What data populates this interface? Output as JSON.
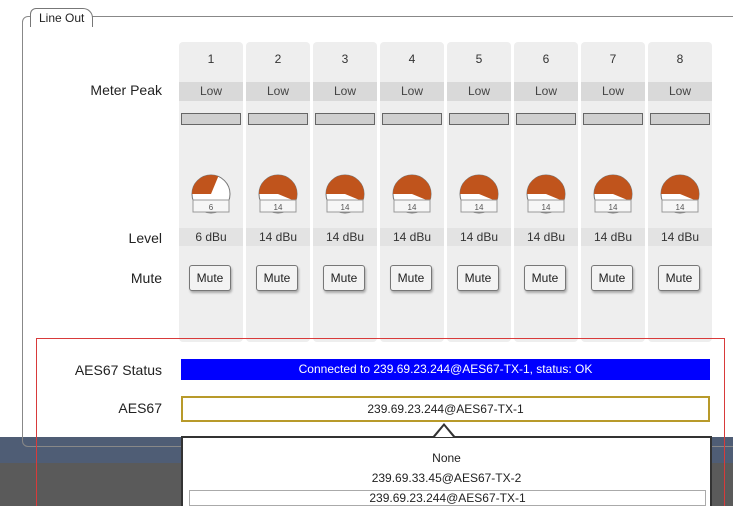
{
  "panel": {
    "title": "Line Out"
  },
  "labels": {
    "meter_peak": "Meter Peak",
    "level": "Level",
    "mute": "Mute",
    "aes67_status": "AES67 Status",
    "aes67": "AES67"
  },
  "channels": [
    {
      "number": "1",
      "peak": "Low",
      "knob_value": "6",
      "level": "6 dBu",
      "mute": "Mute"
    },
    {
      "number": "2",
      "peak": "Low",
      "knob_value": "14",
      "level": "14 dBu",
      "mute": "Mute"
    },
    {
      "number": "3",
      "peak": "Low",
      "knob_value": "14",
      "level": "14 dBu",
      "mute": "Mute"
    },
    {
      "number": "4",
      "peak": "Low",
      "knob_value": "14",
      "level": "14 dBu",
      "mute": "Mute"
    },
    {
      "number": "5",
      "peak": "Low",
      "knob_value": "14",
      "level": "14 dBu",
      "mute": "Mute"
    },
    {
      "number": "6",
      "peak": "Low",
      "knob_value": "14",
      "level": "14 dBu",
      "mute": "Mute"
    },
    {
      "number": "7",
      "peak": "Low",
      "knob_value": "14",
      "level": "14 dBu",
      "mute": "Mute"
    },
    {
      "number": "8",
      "peak": "Low",
      "knob_value": "14",
      "level": "14 dBu",
      "mute": "Mute"
    }
  ],
  "aes67": {
    "status_text": "Connected to 239.69.23.244@AES67-TX-1, status: OK",
    "status_color": "#0000ff",
    "selected": "239.69.23.244@AES67-TX-1",
    "options": [
      "None",
      "239.69.33.45@AES67-TX-2",
      "239.69.23.244@AES67-TX-1"
    ]
  },
  "colors": {
    "knob_fill": "#c0541c",
    "select_border": "#b89a2a",
    "highlight_border": "#d83a3a"
  }
}
